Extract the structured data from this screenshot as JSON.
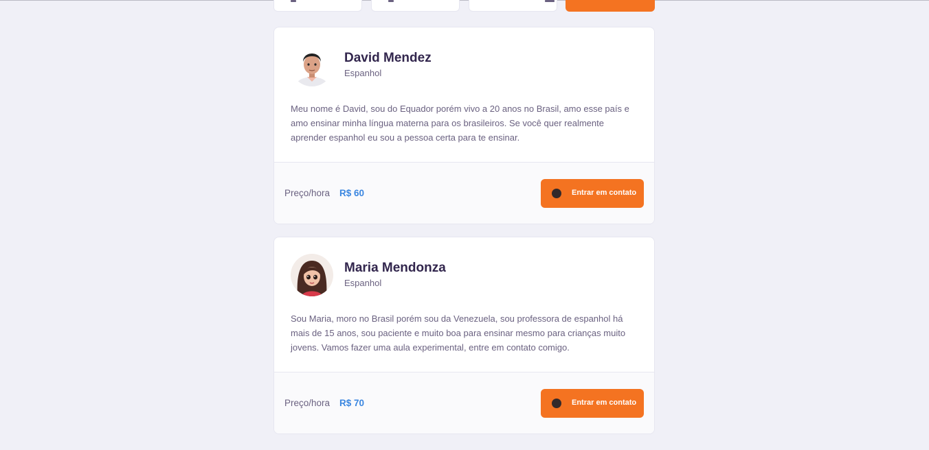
{
  "colors": {
    "background": "#f0f0f7",
    "accent": "#f47321",
    "title": "#32264d",
    "text": "#6a6180",
    "price": "#3a86e0"
  },
  "filters": {
    "search_button_icon": "search-icon"
  },
  "teachers": [
    {
      "name": "David Mendez",
      "subject": "Espanhol",
      "bio": "Meu nome é David, sou do Equador porém vivo a 20 anos no Brasil, amo esse país e amo ensinar minha língua materna para os brasileiros. Se você quer realmente aprender espanhol eu sou a pessoa certa para te ensinar.",
      "price_label": "Preço/hora",
      "price": "R$ 60",
      "contact_label": "Entrar em contato",
      "contact_icon": "whatsapp-icon",
      "avatar": "avatar-man"
    },
    {
      "name": "Maria Mendonza",
      "subject": "Espanhol",
      "bio": "Sou Maria, moro no Brasil porém sou da Venezuela, sou professora de espanhol há mais de 15 anos, sou paciente e muito boa para ensinar mesmo para crianças muito jovens. Vamos fazer uma aula experimental, entre em contato comigo.",
      "price_label": "Preço/hora",
      "price": "R$ 70",
      "contact_label": "Entrar em contato",
      "contact_icon": "whatsapp-icon",
      "avatar": "avatar-woman"
    }
  ]
}
